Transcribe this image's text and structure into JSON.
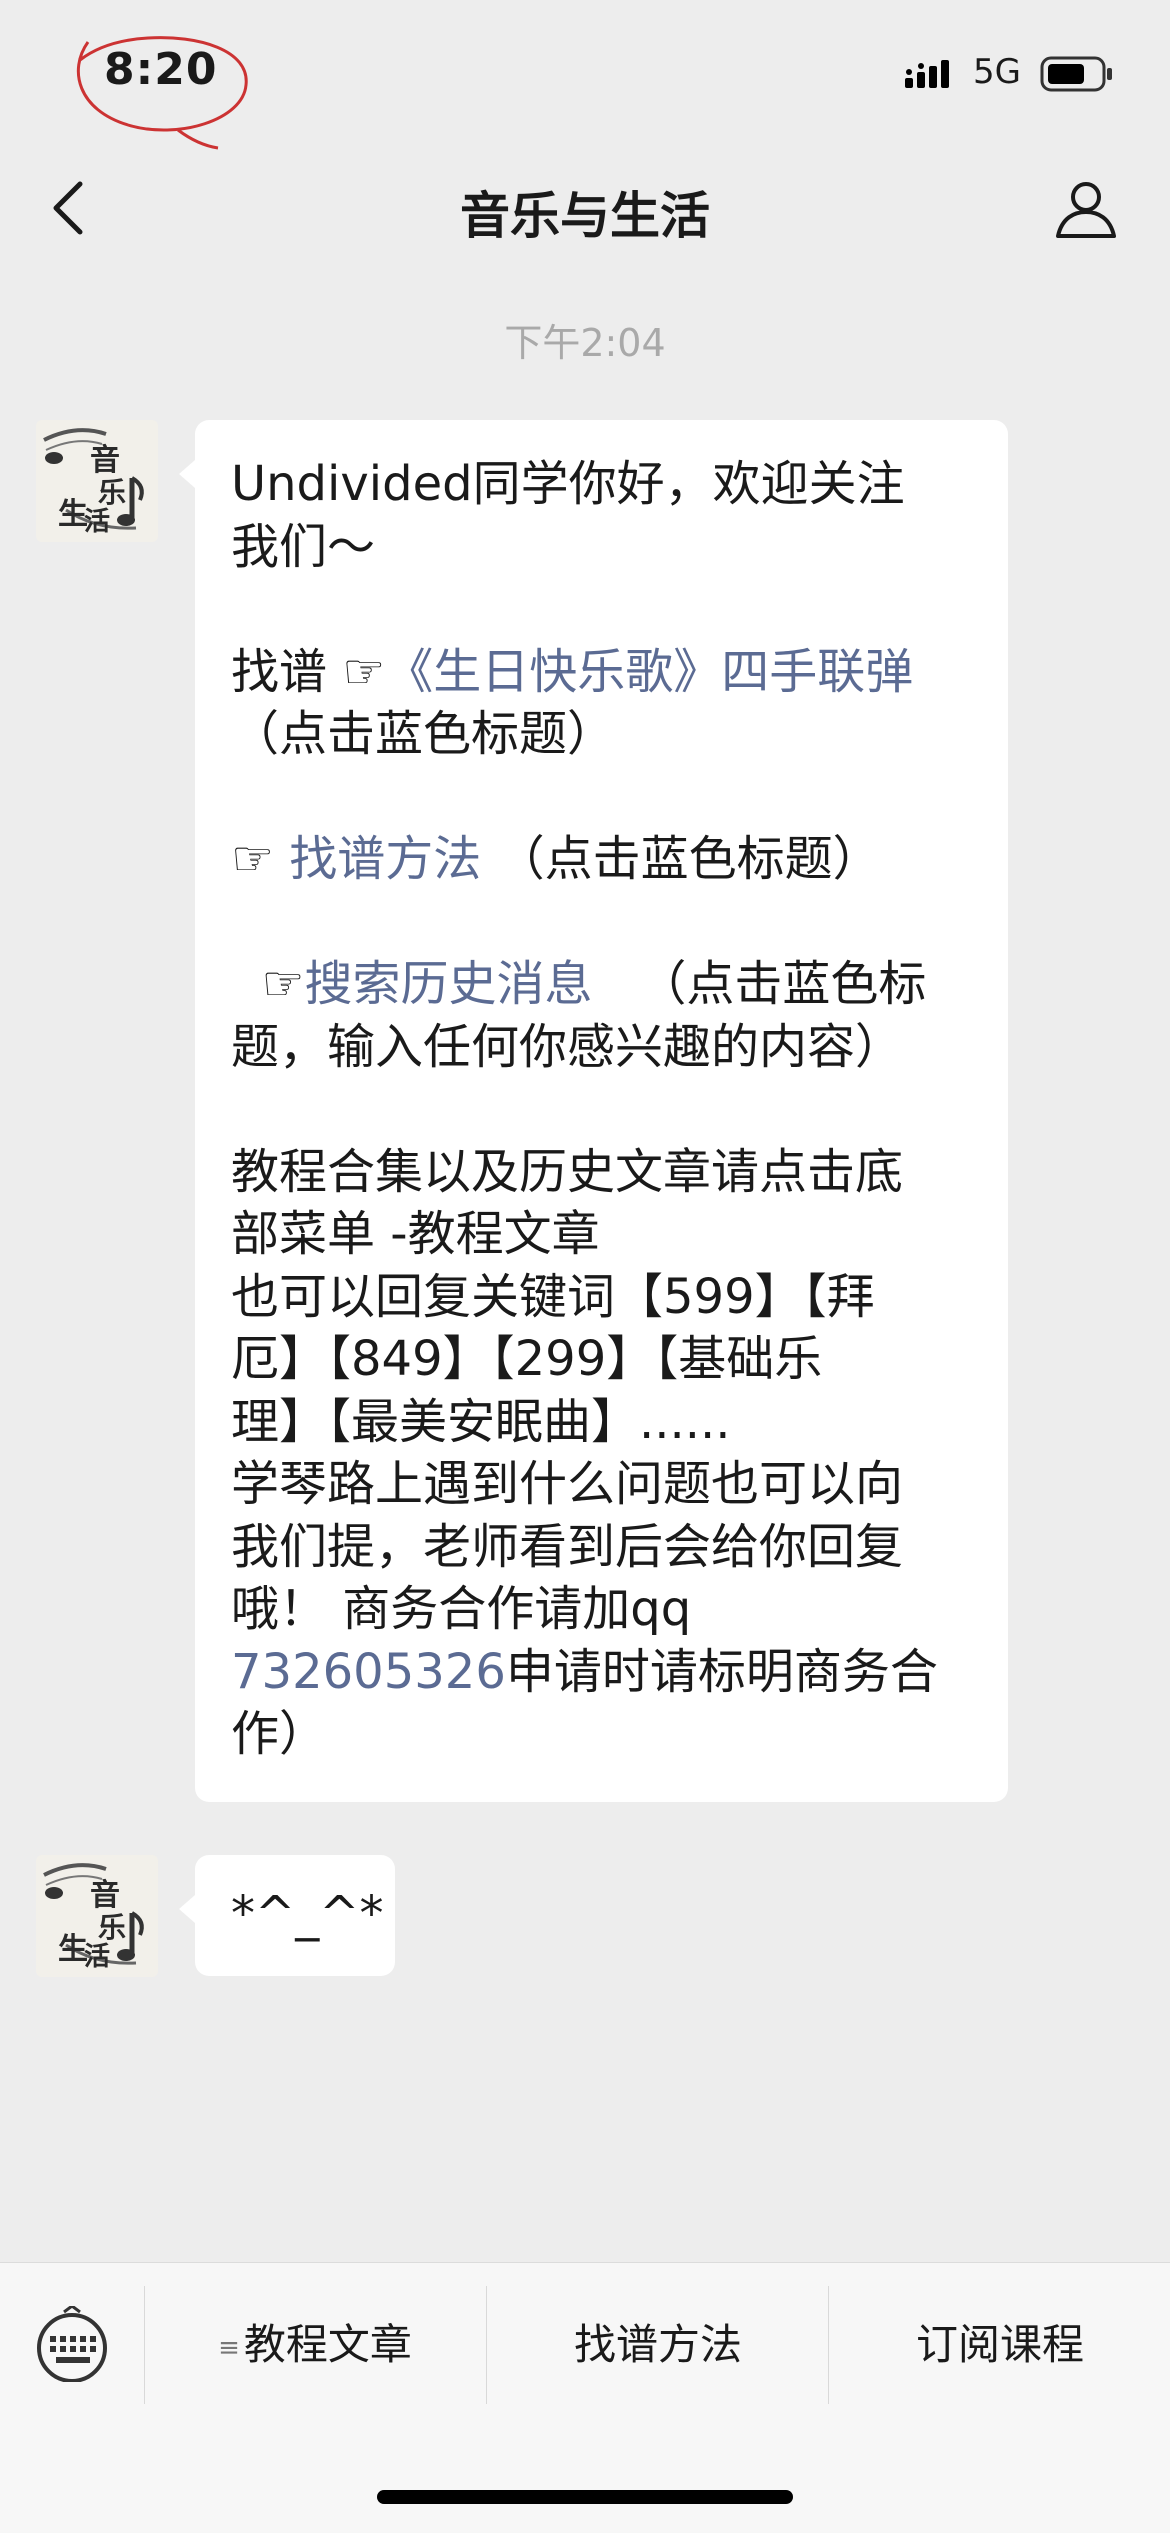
{
  "status_bar": {
    "time": "8:20",
    "network": "5G"
  },
  "header": {
    "title": "音乐与生活"
  },
  "chat": {
    "timestamp": "下午2:04",
    "message1": {
      "l1": "Undivided同学你好，欢迎关注",
      "l2": "我们～",
      "l4_prefix": "找谱 ☞",
      "l4_link": "《生日快乐歌》四手联弹",
      "l5": "（点击蓝色标题）",
      "l7_prefix": "☞ ",
      "l7_link": "找谱方法",
      "l7_suffix": " （点击蓝色标题）",
      "l9_prefix": "  ☞",
      "l9_link": "搜索历史消息",
      "l9_suffix": "   （点击蓝色标",
      "l10": "题，输入任何你感兴趣的内容）",
      "l12": "教程合集以及历史文章请点击底",
      "l13": "部菜单 -教程文章",
      "l14": "也可以回复关键词【599】【拜",
      "l15": "厄】【849】【299】【基础乐",
      "l16": "理】【最美安眠曲】......",
      "l17": "学琴路上遇到什么问题也可以向",
      "l18": "我们提，老师看到后会给你回复",
      "l19": "哦！ 商务合作请加qq",
      "l20_link": "732605326",
      "l20_suffix": "申请时请标明商务合",
      "l21": "作）"
    },
    "message2": {
      "text": "*^_^*"
    }
  },
  "menu": {
    "item1": "教程文章",
    "item1_marker": "≡",
    "item2": "找谱方法",
    "item3": "订阅课程"
  },
  "colors": {
    "link": "#5b6b93",
    "background": "#ededed",
    "bubble": "#ffffff"
  }
}
